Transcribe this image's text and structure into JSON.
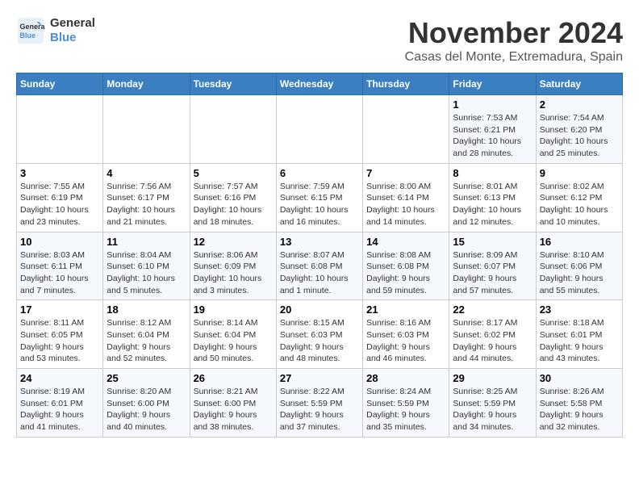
{
  "logo": {
    "line1": "General",
    "line2": "Blue"
  },
  "header": {
    "month": "November 2024",
    "location": "Casas del Monte, Extremadura, Spain"
  },
  "columns": [
    "Sunday",
    "Monday",
    "Tuesday",
    "Wednesday",
    "Thursday",
    "Friday",
    "Saturday"
  ],
  "weeks": [
    {
      "days": [
        {
          "num": "",
          "info": ""
        },
        {
          "num": "",
          "info": ""
        },
        {
          "num": "",
          "info": ""
        },
        {
          "num": "",
          "info": ""
        },
        {
          "num": "",
          "info": ""
        },
        {
          "num": "1",
          "info": "Sunrise: 7:53 AM\nSunset: 6:21 PM\nDaylight: 10 hours\nand 28 minutes."
        },
        {
          "num": "2",
          "info": "Sunrise: 7:54 AM\nSunset: 6:20 PM\nDaylight: 10 hours\nand 25 minutes."
        }
      ]
    },
    {
      "days": [
        {
          "num": "3",
          "info": "Sunrise: 7:55 AM\nSunset: 6:19 PM\nDaylight: 10 hours\nand 23 minutes."
        },
        {
          "num": "4",
          "info": "Sunrise: 7:56 AM\nSunset: 6:17 PM\nDaylight: 10 hours\nand 21 minutes."
        },
        {
          "num": "5",
          "info": "Sunrise: 7:57 AM\nSunset: 6:16 PM\nDaylight: 10 hours\nand 18 minutes."
        },
        {
          "num": "6",
          "info": "Sunrise: 7:59 AM\nSunset: 6:15 PM\nDaylight: 10 hours\nand 16 minutes."
        },
        {
          "num": "7",
          "info": "Sunrise: 8:00 AM\nSunset: 6:14 PM\nDaylight: 10 hours\nand 14 minutes."
        },
        {
          "num": "8",
          "info": "Sunrise: 8:01 AM\nSunset: 6:13 PM\nDaylight: 10 hours\nand 12 minutes."
        },
        {
          "num": "9",
          "info": "Sunrise: 8:02 AM\nSunset: 6:12 PM\nDaylight: 10 hours\nand 10 minutes."
        }
      ]
    },
    {
      "days": [
        {
          "num": "10",
          "info": "Sunrise: 8:03 AM\nSunset: 6:11 PM\nDaylight: 10 hours\nand 7 minutes."
        },
        {
          "num": "11",
          "info": "Sunrise: 8:04 AM\nSunset: 6:10 PM\nDaylight: 10 hours\nand 5 minutes."
        },
        {
          "num": "12",
          "info": "Sunrise: 8:06 AM\nSunset: 6:09 PM\nDaylight: 10 hours\nand 3 minutes."
        },
        {
          "num": "13",
          "info": "Sunrise: 8:07 AM\nSunset: 6:08 PM\nDaylight: 10 hours\nand 1 minute."
        },
        {
          "num": "14",
          "info": "Sunrise: 8:08 AM\nSunset: 6:08 PM\nDaylight: 9 hours\nand 59 minutes."
        },
        {
          "num": "15",
          "info": "Sunrise: 8:09 AM\nSunset: 6:07 PM\nDaylight: 9 hours\nand 57 minutes."
        },
        {
          "num": "16",
          "info": "Sunrise: 8:10 AM\nSunset: 6:06 PM\nDaylight: 9 hours\nand 55 minutes."
        }
      ]
    },
    {
      "days": [
        {
          "num": "17",
          "info": "Sunrise: 8:11 AM\nSunset: 6:05 PM\nDaylight: 9 hours\nand 53 minutes."
        },
        {
          "num": "18",
          "info": "Sunrise: 8:12 AM\nSunset: 6:04 PM\nDaylight: 9 hours\nand 52 minutes."
        },
        {
          "num": "19",
          "info": "Sunrise: 8:14 AM\nSunset: 6:04 PM\nDaylight: 9 hours\nand 50 minutes."
        },
        {
          "num": "20",
          "info": "Sunrise: 8:15 AM\nSunset: 6:03 PM\nDaylight: 9 hours\nand 48 minutes."
        },
        {
          "num": "21",
          "info": "Sunrise: 8:16 AM\nSunset: 6:03 PM\nDaylight: 9 hours\nand 46 minutes."
        },
        {
          "num": "22",
          "info": "Sunrise: 8:17 AM\nSunset: 6:02 PM\nDaylight: 9 hours\nand 44 minutes."
        },
        {
          "num": "23",
          "info": "Sunrise: 8:18 AM\nSunset: 6:01 PM\nDaylight: 9 hours\nand 43 minutes."
        }
      ]
    },
    {
      "days": [
        {
          "num": "24",
          "info": "Sunrise: 8:19 AM\nSunset: 6:01 PM\nDaylight: 9 hours\nand 41 minutes."
        },
        {
          "num": "25",
          "info": "Sunrise: 8:20 AM\nSunset: 6:00 PM\nDaylight: 9 hours\nand 40 minutes."
        },
        {
          "num": "26",
          "info": "Sunrise: 8:21 AM\nSunset: 6:00 PM\nDaylight: 9 hours\nand 38 minutes."
        },
        {
          "num": "27",
          "info": "Sunrise: 8:22 AM\nSunset: 5:59 PM\nDaylight: 9 hours\nand 37 minutes."
        },
        {
          "num": "28",
          "info": "Sunrise: 8:24 AM\nSunset: 5:59 PM\nDaylight: 9 hours\nand 35 minutes."
        },
        {
          "num": "29",
          "info": "Sunrise: 8:25 AM\nSunset: 5:59 PM\nDaylight: 9 hours\nand 34 minutes."
        },
        {
          "num": "30",
          "info": "Sunrise: 8:26 AM\nSunset: 5:58 PM\nDaylight: 9 hours\nand 32 minutes."
        }
      ]
    }
  ]
}
